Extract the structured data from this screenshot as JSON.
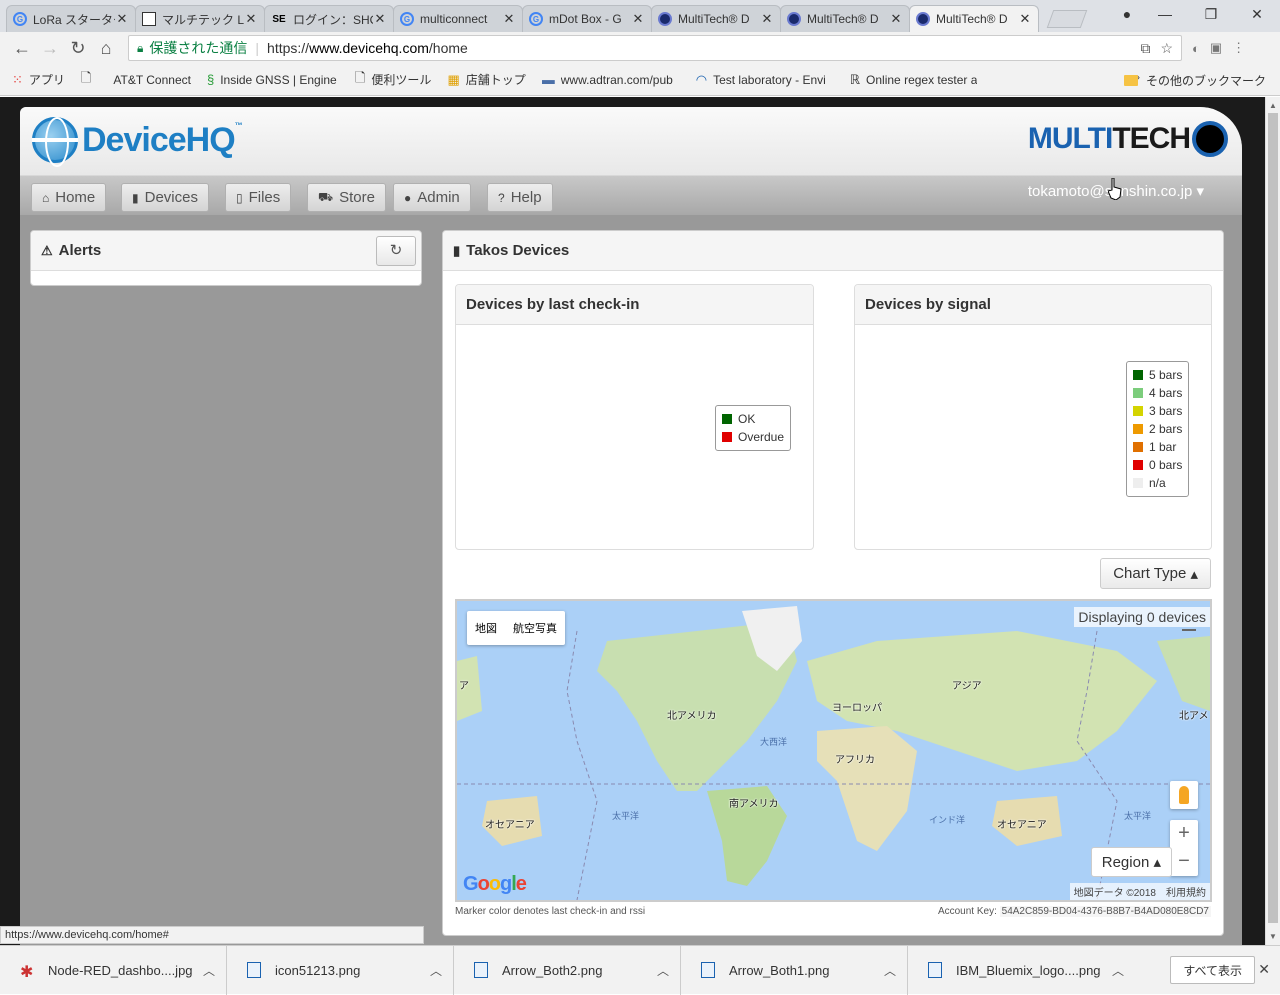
{
  "browser": {
    "tabs": [
      {
        "title": "LoRa スターター",
        "icon": "google-icon"
      },
      {
        "title": "マルチテック Lo",
        "icon": "doc-icon"
      },
      {
        "title": "ログイン：SHO",
        "icon": "se-icon"
      },
      {
        "title": "multiconnect",
        "icon": "google-icon"
      },
      {
        "title": "mDot Box - G",
        "icon": "google-icon"
      },
      {
        "title": "MultiTech® D",
        "icon": "multitech-icon"
      },
      {
        "title": "MultiTech® D",
        "icon": "multitech-icon"
      },
      {
        "title": "MultiTech® D",
        "icon": "multitech-icon"
      }
    ],
    "secure_label": "保護された通信",
    "url_scheme": "https://",
    "url_host": "www.devicehq.com",
    "url_path": "/home",
    "bookmarks": [
      {
        "label": "アプリ",
        "icon": "apps-icon"
      },
      {
        "label": "",
        "icon": "page-icon"
      },
      {
        "label": "AT&T Connect",
        "icon": "page-icon"
      },
      {
        "label": "Inside GNSS | Engine",
        "icon": "gnss-icon"
      },
      {
        "label": "便利ツール",
        "icon": "page-icon"
      },
      {
        "label": "店舗トップ",
        "icon": "shop-icon"
      },
      {
        "label": "www.adtran.com/pub",
        "icon": "adtran-icon"
      },
      {
        "label": "Test laboratory - Envi",
        "icon": "wifi-icon"
      },
      {
        "label": "Online regex tester a",
        "icon": "regex-icon"
      }
    ],
    "bookmarks_more": "»",
    "other_bookmarks": "その他のブックマーク",
    "status_url": "https://www.devicehq.com/home#"
  },
  "app": {
    "brand_left": "DeviceHQ",
    "brand_left_tm": "™",
    "brand_right_multi": "MULTI",
    "brand_right_tech": "TECH",
    "nav": [
      {
        "label": "Home",
        "icon": "home-icon"
      },
      {
        "label": "Devices",
        "icon": "bar-chart-icon"
      },
      {
        "label": "Files",
        "icon": "file-icon"
      },
      {
        "label": "Store",
        "icon": "cart-icon"
      },
      {
        "label": "Admin",
        "icon": "user-icon"
      },
      {
        "label": "Help",
        "icon": "question-icon"
      }
    ],
    "user": "tokamoto@sunshin.co.jp",
    "alerts_title": "Alerts",
    "devices_title": "Takos Devices",
    "checkin_title": "Devices by last check-in",
    "checkin_legend": [
      {
        "label": "OK",
        "color": "#006400"
      },
      {
        "label": "Overdue",
        "color": "#e00000"
      }
    ],
    "signal_title": "Devices by signal",
    "signal_legend": [
      {
        "label": "5 bars",
        "color": "#006400"
      },
      {
        "label": "4 bars",
        "color": "#7ccd7c"
      },
      {
        "label": "3 bars",
        "color": "#d4d400"
      },
      {
        "label": "2 bars",
        "color": "#ee9a00"
      },
      {
        "label": "1 bar",
        "color": "#e07000"
      },
      {
        "label": "0 bars",
        "color": "#e00000"
      },
      {
        "label": "n/a",
        "color": "#eeeeee"
      }
    ],
    "chart_type_label": "Chart Type",
    "map": {
      "type_map": "地図",
      "type_satellite": "航空写真",
      "displaying": "Displaying 0 devices",
      "region_label": "Region",
      "zoom_in": "+",
      "zoom_out": "−",
      "copyright": "地図データ ©2018",
      "terms": "利用規約",
      "labels": {
        "na": "北アメリカ",
        "europe": "ヨーロッパ",
        "asia": "アジア",
        "africa": "アフリカ",
        "sa": "南アメリカ",
        "oceania_l": "オセアニア",
        "oceania_r": "オセアニア",
        "asia_edge": "ア",
        "na_edge": "北アメ",
        "atlantic": "大西洋",
        "pacific_l": "太平洋",
        "pacific_r": "太平洋",
        "indian": "インド洋"
      }
    },
    "footnote": "Marker color denotes last check-in and rssi",
    "account_key_label": "Account Key:",
    "account_key": "54A2C859-BD04-4376-B8B7-B4AD080E8CD7"
  },
  "downloads": {
    "items": [
      {
        "name": "Node-RED_dashbo....jpg",
        "icon": "image-icon"
      },
      {
        "name": "icon51213.png",
        "icon": "image-icon"
      },
      {
        "name": "Arrow_Both2.png",
        "icon": "image-icon"
      },
      {
        "name": "Arrow_Both1.png",
        "icon": "image-icon"
      },
      {
        "name": "IBM_Bluemix_logo....png",
        "icon": "image-icon"
      }
    ],
    "show_all": "すべて表示"
  }
}
